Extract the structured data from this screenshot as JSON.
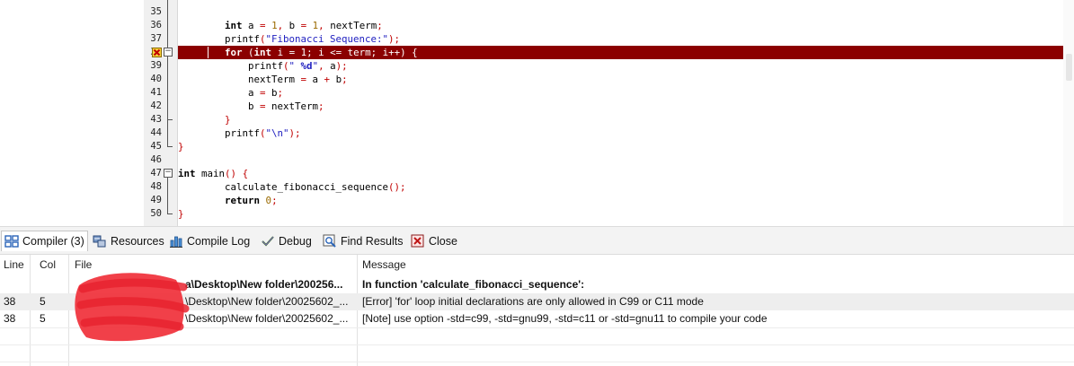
{
  "editor": {
    "lines": [
      {
        "num": "35",
        "segments": []
      },
      {
        "num": "36",
        "segments": [
          {
            "t": "        ",
            "c": "id"
          },
          {
            "t": "int",
            "c": "kw"
          },
          {
            "t": " a ",
            "c": "id"
          },
          {
            "t": "=",
            "c": "op"
          },
          {
            "t": " ",
            "c": "id"
          },
          {
            "t": "1",
            "c": "num"
          },
          {
            "t": ",",
            "c": "op"
          },
          {
            "t": " b ",
            "c": "id"
          },
          {
            "t": "=",
            "c": "op"
          },
          {
            "t": " ",
            "c": "id"
          },
          {
            "t": "1",
            "c": "num"
          },
          {
            "t": ",",
            "c": "op"
          },
          {
            "t": " nextTerm",
            "c": "id"
          },
          {
            "t": ";",
            "c": "op"
          }
        ]
      },
      {
        "num": "37",
        "segments": [
          {
            "t": "        printf",
            "c": "id"
          },
          {
            "t": "(",
            "c": "op"
          },
          {
            "t": "\"Fibonacci Sequence:\"",
            "c": "str"
          },
          {
            "t": ");",
            "c": "op"
          }
        ]
      },
      {
        "num": "38",
        "error": true,
        "segments": [
          {
            "t": "        ",
            "c": "id"
          },
          {
            "t": "for",
            "c": "kw"
          },
          {
            "t": " (",
            "c": "op"
          },
          {
            "t": "int",
            "c": "kw"
          },
          {
            "t": " i = 1; i <= term; i++) {",
            "c": "id"
          }
        ]
      },
      {
        "num": "39",
        "segments": [
          {
            "t": "            printf",
            "c": "id"
          },
          {
            "t": "(",
            "c": "op"
          },
          {
            "t": "\" ",
            "c": "str"
          },
          {
            "t": "%d",
            "c": "fmt"
          },
          {
            "t": "\"",
            "c": "str"
          },
          {
            "t": ",",
            "c": "op"
          },
          {
            "t": " a",
            "c": "id"
          },
          {
            "t": ");",
            "c": "op"
          }
        ]
      },
      {
        "num": "40",
        "segments": [
          {
            "t": "            nextTerm ",
            "c": "id"
          },
          {
            "t": "=",
            "c": "op"
          },
          {
            "t": " a ",
            "c": "id"
          },
          {
            "t": "+",
            "c": "op"
          },
          {
            "t": " b",
            "c": "id"
          },
          {
            "t": ";",
            "c": "op"
          }
        ]
      },
      {
        "num": "41",
        "segments": [
          {
            "t": "            a ",
            "c": "id"
          },
          {
            "t": "=",
            "c": "op"
          },
          {
            "t": " b",
            "c": "id"
          },
          {
            "t": ";",
            "c": "op"
          }
        ]
      },
      {
        "num": "42",
        "segments": [
          {
            "t": "            b ",
            "c": "id"
          },
          {
            "t": "=",
            "c": "op"
          },
          {
            "t": " nextTerm",
            "c": "id"
          },
          {
            "t": ";",
            "c": "op"
          }
        ]
      },
      {
        "num": "43",
        "segments": [
          {
            "t": "        ",
            "c": "id"
          },
          {
            "t": "}",
            "c": "op"
          }
        ]
      },
      {
        "num": "44",
        "segments": [
          {
            "t": "        printf",
            "c": "id"
          },
          {
            "t": "(",
            "c": "op"
          },
          {
            "t": "\"\\n\"",
            "c": "str"
          },
          {
            "t": ");",
            "c": "op"
          }
        ]
      },
      {
        "num": "45",
        "segments": [
          {
            "t": "}",
            "c": "op"
          }
        ]
      },
      {
        "num": "46",
        "segments": []
      },
      {
        "num": "47",
        "segments": [
          {
            "t": "int",
            "c": "kw"
          },
          {
            "t": " main",
            "c": "id"
          },
          {
            "t": "()",
            "c": "op"
          },
          {
            "t": " ",
            "c": "id"
          },
          {
            "t": "{",
            "c": "op"
          }
        ]
      },
      {
        "num": "48",
        "segments": [
          {
            "t": "        calculate_fibonacci_sequence",
            "c": "id"
          },
          {
            "t": "();",
            "c": "op"
          }
        ]
      },
      {
        "num": "49",
        "segments": [
          {
            "t": "        ",
            "c": "id"
          },
          {
            "t": "return",
            "c": "kw"
          },
          {
            "t": " ",
            "c": "id"
          },
          {
            "t": "0",
            "c": "num"
          },
          {
            "t": ";",
            "c": "op"
          }
        ]
      },
      {
        "num": "50",
        "segments": [
          {
            "t": "}",
            "c": "op"
          }
        ]
      }
    ]
  },
  "tabs": [
    {
      "label": "Compiler (3)",
      "icon": "compiler-grid-icon",
      "name": "tab-compiler"
    },
    {
      "label": "Resources",
      "icon": "resources-icon",
      "name": "tab-resources"
    },
    {
      "label": "Compile Log",
      "icon": "bar-chart-icon",
      "name": "tab-compile-log"
    },
    {
      "label": "Debug",
      "icon": "checkmark-icon",
      "name": "tab-debug"
    },
    {
      "label": "Find Results",
      "icon": "find-icon",
      "name": "tab-find-results"
    },
    {
      "label": "Close",
      "icon": "close-icon",
      "name": "tab-close"
    }
  ],
  "messages": {
    "headers": {
      "line": "Line",
      "col": "Col",
      "file": "File",
      "message": "Message"
    },
    "rows": [
      {
        "line": "",
        "col": "",
        "file": "a\\Desktop\\New folder\\200256...",
        "message": "In function 'calculate_fibonacci_sequence':",
        "bold": true
      },
      {
        "line": "38",
        "col": "5",
        "file": "\\Desktop\\New folder\\20025602_...",
        "message": "[Error] 'for' loop initial declarations are only allowed in C99 or C11 mode"
      },
      {
        "line": "38",
        "col": "5",
        "file": "\\Desktop\\New folder\\20025602_...",
        "message": "[Note] use option -std=c99, -std=gnu99, -std=c11 or -std=gnu11 to compile your code"
      }
    ]
  },
  "colors": {
    "error_line": "#8b0000",
    "redaction": "#f0303a"
  }
}
